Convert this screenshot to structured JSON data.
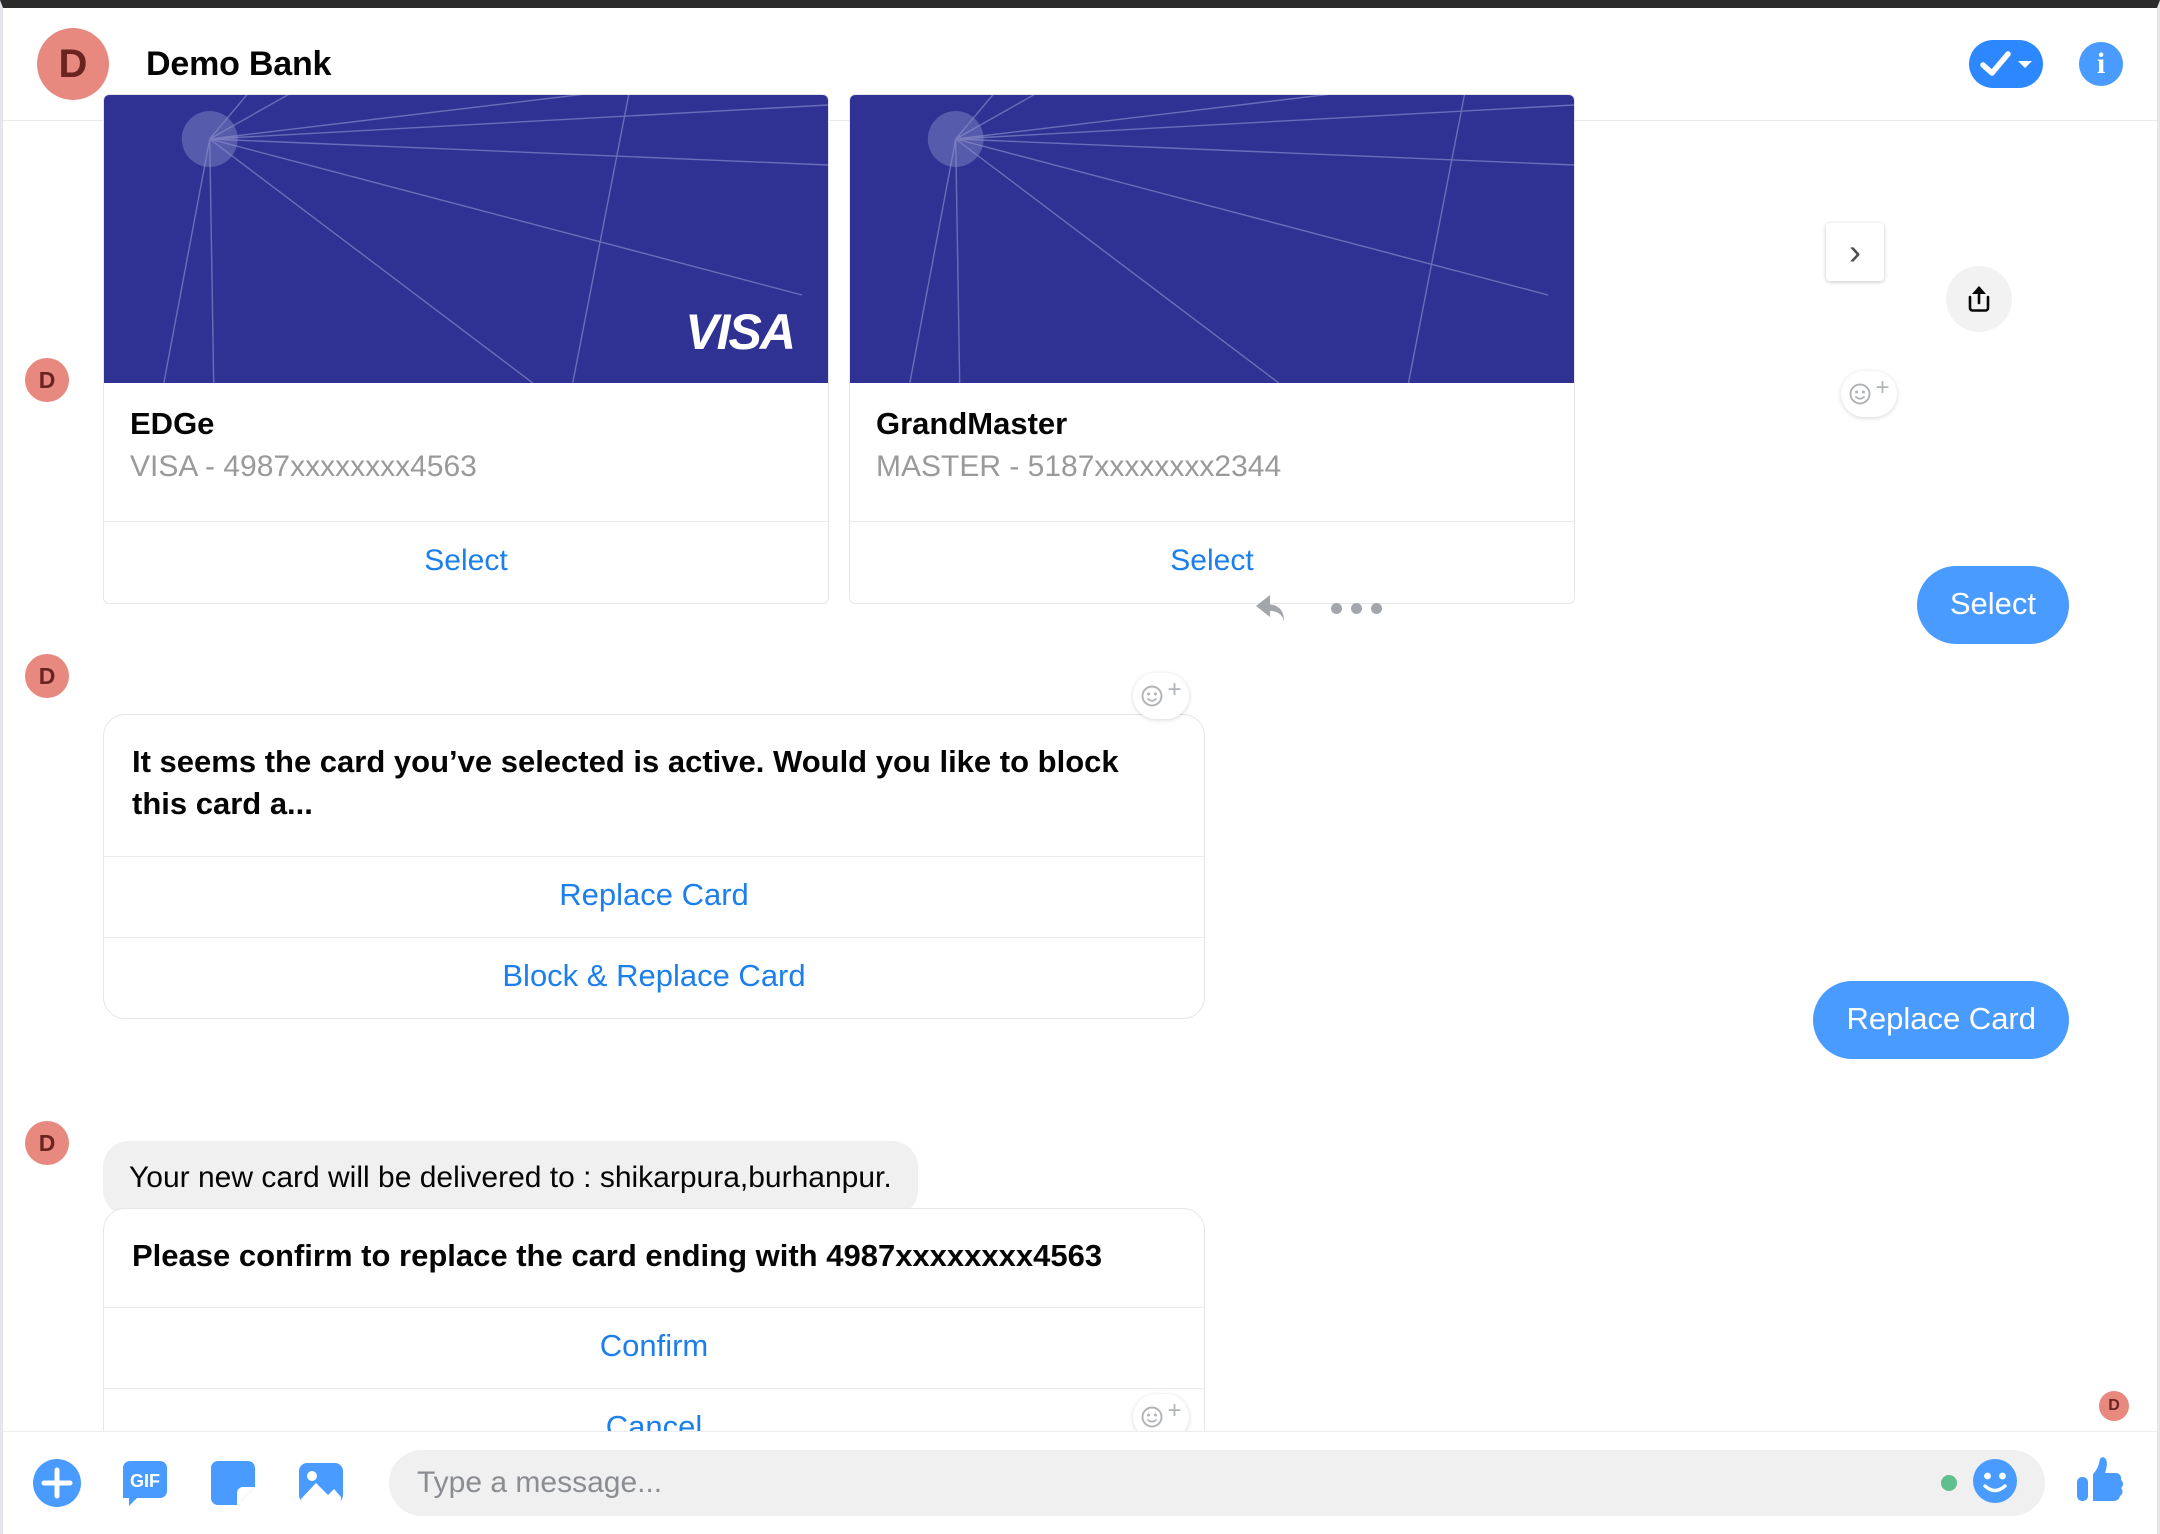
{
  "header": {
    "avatar_initial": "D",
    "title": "Demo Bank",
    "check_icon": "check-dropdown-icon",
    "info_icon": "info-icon",
    "info_glyph": "i"
  },
  "carousel": {
    "next_label": "›",
    "share_icon": "share-icon",
    "cards": [
      {
        "title": "EDGe",
        "subtitle": "VISA - 4987xxxxxxxx4563",
        "brand_logo": "VISA",
        "action_label": "Select"
      },
      {
        "title": "GrandMaster",
        "subtitle": "MASTER - 5187xxxxxxxx2344",
        "brand_logo": "",
        "action_label": "Select"
      }
    ]
  },
  "messages": {
    "sent_select": "Select",
    "block_prompt": {
      "text": "It seems the card you’ve selected is active. Would you like to block this card a...",
      "buttons": [
        "Replace Card",
        "Block & Replace Card"
      ]
    },
    "sent_replace": "Replace Card",
    "delivery_note": "Your new card will be delivered to : shikarpura,burhanpur.",
    "confirm_prompt": {
      "text": "Please confirm to replace the card ending with 4987xxxxxxxx4563",
      "buttons": [
        "Confirm",
        "Cancel"
      ]
    }
  },
  "avatars": {
    "row_initial": "D",
    "seen_initial": "D"
  },
  "reactions": {
    "add_label": "+"
  },
  "composer": {
    "plus_icon": "plus-circle-icon",
    "gif_icon": "gif-icon",
    "gif_label": "GIF",
    "sticker_icon": "sticker-icon",
    "photo_icon": "photo-icon",
    "placeholder": "Type a message...",
    "value": "",
    "emoji_icon": "emoji-icon",
    "thumbs_icon": "thumbs-up-icon"
  },
  "colors": {
    "accent_blue": "#4a9bff",
    "link_blue": "#1d7fec",
    "card_blue": "#2f3293",
    "avatar_pink": "#e8897f",
    "bubble_grey": "#f0f0f0"
  }
}
